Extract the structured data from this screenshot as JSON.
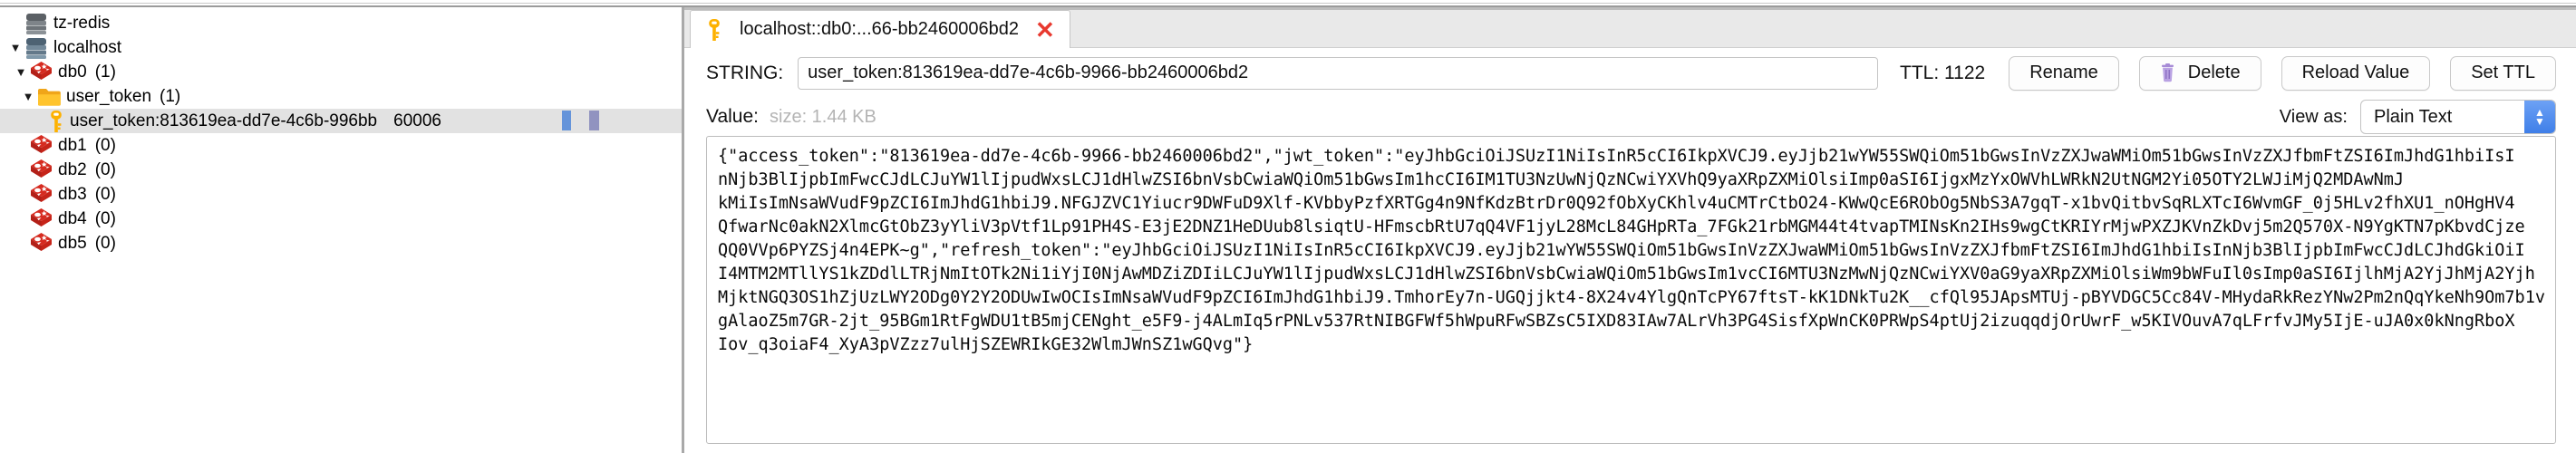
{
  "sidebar": {
    "nodes": [
      {
        "label": "tz-redis",
        "count": "",
        "icon": "server-icon",
        "depth": 0,
        "twisty": "",
        "selected": false
      },
      {
        "label": "localhost",
        "count": "",
        "icon": "server-icon",
        "depth": 0,
        "twisty": "▼",
        "selected": false
      },
      {
        "label": "db0",
        "count": "(1)",
        "icon": "redis-db-icon",
        "depth": 1,
        "twisty": "▼",
        "selected": false
      },
      {
        "label": "user_token",
        "count": "(1)",
        "icon": "folder-icon",
        "depth": 2,
        "twisty": "▼",
        "selected": false
      },
      {
        "label": "user_token:813619ea-dd7e-4c6b-996",
        "count": "bb",
        "icon": "key-icon",
        "depth": 3,
        "twisty": "",
        "selected": true,
        "trailing": "60006"
      },
      {
        "label": "db1",
        "count": "(0)",
        "icon": "redis-db-icon",
        "depth": 1,
        "twisty": "",
        "selected": false
      },
      {
        "label": "db2",
        "count": "(0)",
        "icon": "redis-db-icon",
        "depth": 1,
        "twisty": "",
        "selected": false
      },
      {
        "label": "db3",
        "count": "(0)",
        "icon": "redis-db-icon",
        "depth": 1,
        "twisty": "",
        "selected": false
      },
      {
        "label": "db4",
        "count": "(0)",
        "icon": "redis-db-icon",
        "depth": 1,
        "twisty": "",
        "selected": false
      },
      {
        "label": "db5",
        "count": "(0)",
        "icon": "redis-db-icon",
        "depth": 1,
        "twisty": "",
        "selected": false
      }
    ]
  },
  "tab": {
    "title": "localhost::db0:...66-bb2460006bd2",
    "close_label": "✕"
  },
  "key_row": {
    "type_label": "STRING:",
    "key_value": "user_token:813619ea-dd7e-4c6b-9966-bb2460006bd2",
    "ttl_label": "TTL: 1122",
    "rename_label": "Rename",
    "delete_label": "Delete",
    "reload_label": "Reload Value",
    "set_ttl_label": "Set TTL"
  },
  "value_row": {
    "value_label": "Value:",
    "size_label": "size: 1.44 KB",
    "view_as_label": "View as:",
    "view_as_value": "Plain Text"
  },
  "value_content": "{\"access_token\":\"813619ea-dd7e-4c6b-9966-bb2460006bd2\",\"jwt_token\":\"eyJhbGciOiJSUzI1NiIsInR5cCI6IkpXVCJ9.eyJjb21wYW55SWQiOm51bGwsInVzZXJwaWMiOm51bGwsInVzZXJfbmFtZSI6ImJhdG1hbiIsI\nnNjb3BlIjpbImFwcCJdLCJuYW1lIjpudWxsLCJ1dHlwZSI6bnVsbCwiaWQiOm51bGwsIm1hcCI6IM1TU3NzUwNjQzNCwiYXVhQ9yaXRpZXMiOlsiImp0aSI6IjgxMzYxOWVhLWRkN2UtNGM2Yi05OTY2LWJiMjQ2MDAwNmJ\nkMiIsImNsaWVudF9pZCI6ImJhdG1hbiJ9.NFGJZVC1Yiucr9DWFuD9Xlf-KVbbyPzfXRTGg4n9NfKdzBtrDr0Q92fObXyCKhlv4uCMTrCtbO24-KWwQcE6RObOg5NbS3A7gqT-x1bvQitbvSqRLXTcI6WvmGF_0j5HLv2fhXU1_nOHgHV4\nQfwarNc0akN2XlmcGtObZ3yYliV3pVtf1Lp91PH4S-E3jE2DNZ1HeDUub8lsiqtU-HFmscbRtU7qQ4VF1jyL28McL84GHpRTa_7FGk21rbMGM44t4tvapTMINsKn2IHs9wgCtKRIYrMjwPXZJKVnZkDvj5m2Q570X-N9YgKTN7pKbvdCjze\nQQ0VVp6PYZSj4n4EPK~g\",\"refresh_token\":\"eyJhbGciOiJSUzI1NiIsInR5cCI6IkpXVCJ9.eyJjb21wYW55SWQiOm51bGwsInVzZXJwaWMiOm51bGwsInVzZXJfbmFtZSI6ImJhdG1hbiIsInNjb3BlIjpbImFwcCJdLCJhdGkiOiI\nI4MTM2MTllYS1kZDdlLTRjNmItOTk2Ni1iYjI0NjAwMDZiZDIiLCJuYW1lIjpudWxsLCJ1dHlwZSI6bnVsbCwiaWQiOm51bGwsIm1vcCI6MTU3NzMwNjQzNCwiYXV0aG9yaXRpZXMiOlsiWm9bWFuIl0sImp0aSI6IjlhMjA2YjJhMjA2Yjh\nMjktNGQ3OS1hZjUzLWY2ODg0Y2Y2ODUwIwOCIsImNsaWVudF9pZCI6ImJhdG1hbiJ9.TmhorEy7n-UGQjjkt4-8X24v4YlgQnTcPY67ftsT-kK1DNkTu2K__cfQl95JApsMTUj-pBYVDGC5Cc84V-MHydaRkRezYNw2Pm2nQqYkeNh9Om7b1v\ngAlaoZ5m7GR-2jt_95BGm1RtFgWDU1tB5mjCENght_e5F9-j4ALmIq5rPNLv537RtNIBGFWf5hWpuRFwSBZsC5IXD83IAw7ALrVh3PG4SisfXpWnCK0PRWpS4ptUj2izuqqdjOrUwrF_w5KIVOuvA7qLFrfvJMy5IjE-uJA0x0kNngRboX\nIov_q3oiaF4_XyA3pVZzz7ulHjSZEWRIkGE32WlmJWnSZ1wGQvg\"}"
}
